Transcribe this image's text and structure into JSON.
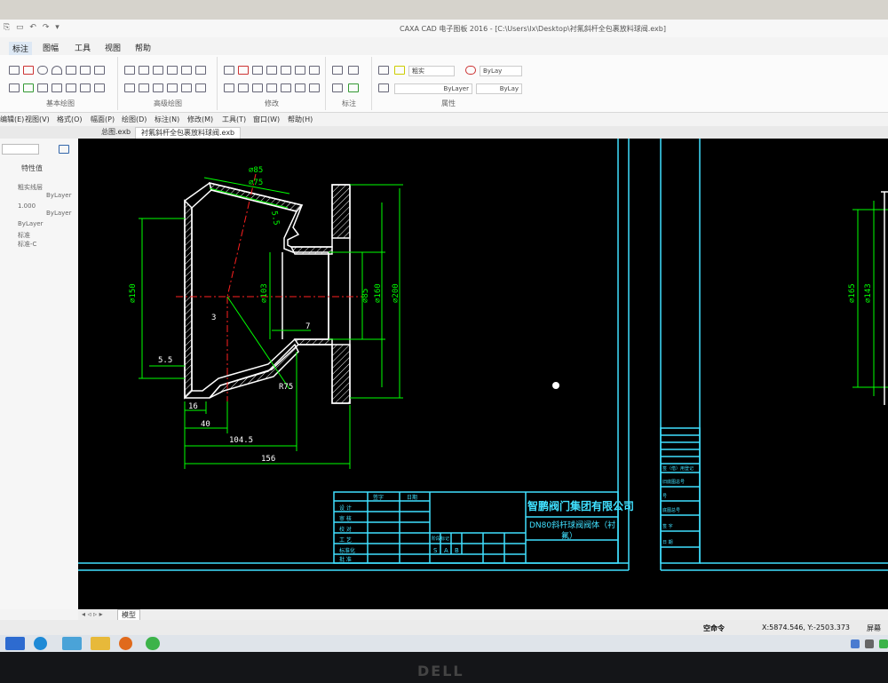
{
  "window": {
    "title": "CAXA CAD 电子图板 2016 - [C:\\Users\\lx\\Desktop\\衬氟斜杆全包裹放料球阀.exb]",
    "quick_access": "⎘ ▭ ↶ ↷ ▾"
  },
  "ribbon_tabs": [
    "标注",
    "图幅",
    "工具",
    "视图",
    "帮助"
  ],
  "ribbon_groups": [
    {
      "label": "基本绘图"
    },
    {
      "label": "高级绘图"
    },
    {
      "label": "修改"
    },
    {
      "label": "标注"
    },
    {
      "label": "属性"
    }
  ],
  "ribbon_combos": {
    "layer_top": "粗实",
    "color_top": "ByLay",
    "linetype": "ByLayer",
    "lineweight": "ByLay"
  },
  "menu_bar": [
    "编辑(E)",
    "视图(V)",
    "格式(O)",
    "幅面(P)",
    "绘图(D)",
    "标注(N)",
    "修改(M)",
    "工具(T)",
    "窗口(W)",
    "帮助(H)"
  ],
  "doc_tabs": [
    "总图.exb",
    "衬氟斜杆全包裹放料球阀.exb"
  ],
  "properties_panel": {
    "header": "特性值",
    "rows": [
      "粗实线层",
      "ByLayer",
      "1.000",
      "ByLayer",
      "ByLayer",
      "标准",
      "标准-C"
    ]
  },
  "drawing": {
    "dimensions": {
      "d85": "⌀85",
      "d75": "⌀75",
      "d150": "⌀150",
      "d103": "⌀103",
      "r85": "⌀85",
      "d160": "⌀160",
      "d200": "⌀200",
      "d165": "⌀165",
      "d143": "⌀143",
      "v3": "3",
      "v7": "7",
      "v55": "5.5",
      "v55b": "5.5",
      "r75": "R75",
      "v16": "16",
      "v40": "40",
      "v1045": "104.5",
      "v156": "156"
    },
    "title_block": {
      "company": "智鹏阀门集团有限公司",
      "part_name_line1": "DN80斜杆球阀阀体（衬",
      "part_name_line2": "氟）",
      "col_heads": [
        "签字",
        "日期"
      ],
      "rows": [
        "设 计",
        "审 核",
        "校 对",
        "工 艺",
        "标准化",
        "批 准"
      ],
      "stage_label": "阶段标记",
      "stage_cells": [
        "S",
        "A",
        "B"
      ]
    },
    "side_table": {
      "rows": [
        "签（借）用登记",
        "旧底图总号",
        "号",
        "底图总号",
        "签 字",
        "日 期"
      ]
    }
  },
  "model_tab": "模型",
  "status": {
    "command": "空命令",
    "coords": "X:5874.546, Y:-2503.373",
    "mode": "屏幕"
  },
  "brand": "DELL",
  "colors": {
    "canvas": "#000000",
    "outline": "#ffffff",
    "dimension": "#00ff00",
    "center_line": "#ff2020",
    "frame": "#40e0ff",
    "hatch": "#ffffff"
  }
}
